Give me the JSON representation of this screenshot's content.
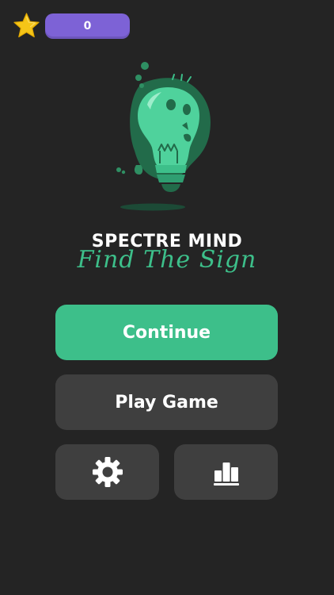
{
  "topbar": {
    "star_icon": "star-icon",
    "star_count": "0",
    "star_color": "#f5c518",
    "pill_color": "#7d62d6"
  },
  "title": {
    "main": "SPECTRE MIND",
    "sub": "Find The Sign"
  },
  "logo": {
    "icon": "lightbulb-skull-icon",
    "color": "#3dbf8a"
  },
  "buttons": {
    "continue_label": "Continue",
    "play_label": "Play Game",
    "settings_icon": "gear-icon",
    "leaderboard_icon": "leaderboard-icon"
  },
  "colors": {
    "background": "#242424",
    "accent": "#3dbf8a",
    "button_dark": "#3f3f3f"
  }
}
